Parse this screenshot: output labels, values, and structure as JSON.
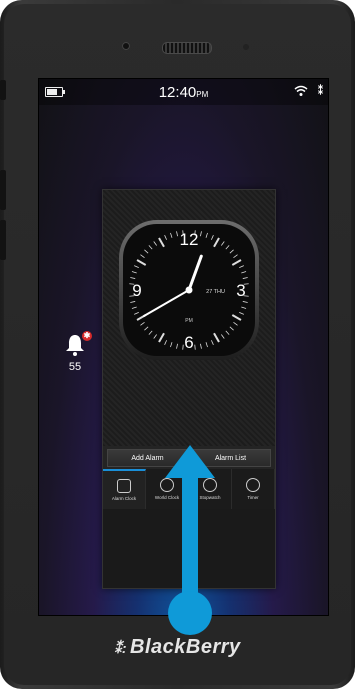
{
  "statusbar": {
    "time": "12:40",
    "time_suffix": "PM",
    "bbm_glyph": "⁑"
  },
  "notification": {
    "count": "55",
    "badge": "✱"
  },
  "clock": {
    "hours": [
      "12",
      "3",
      "6",
      "9"
    ],
    "date": "27 THU",
    "ampm": "PM",
    "hand_hour_deg": 20,
    "hand_minute_deg": 240
  },
  "buttons": {
    "add_alarm": "Add Alarm",
    "alarm_list": "Alarm List"
  },
  "tabs": [
    "Alarm Clock",
    "World Clock",
    "Stopwatch",
    "Timer"
  ],
  "brand": {
    "mark": "⁑:",
    "name": "BlackBerry"
  },
  "colors": {
    "arrow": "#0f9ad8",
    "accent": "#1a8fd8"
  },
  "gesture": "swipe-up-arrow"
}
